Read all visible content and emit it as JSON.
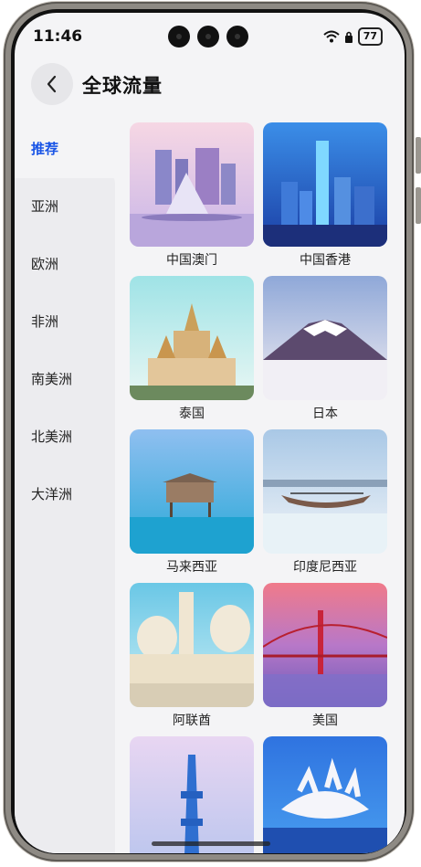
{
  "status": {
    "time": "11:46",
    "battery": "77"
  },
  "header": {
    "title": "全球流量",
    "back_icon": "chevron-left-icon"
  },
  "nav": {
    "items": [
      {
        "label": "推荐",
        "active": true
      },
      {
        "label": "亚洲"
      },
      {
        "label": "欧洲"
      },
      {
        "label": "非洲"
      },
      {
        "label": "南美洲"
      },
      {
        "label": "北美洲"
      },
      {
        "label": "大洋洲"
      }
    ]
  },
  "destinations": [
    {
      "label": "中国澳门"
    },
    {
      "label": "中国香港"
    },
    {
      "label": "泰国"
    },
    {
      "label": "日本"
    },
    {
      "label": "马来西亚"
    },
    {
      "label": "印度尼西亚"
    },
    {
      "label": "阿联酋"
    },
    {
      "label": "美国"
    },
    {
      "label": ""
    },
    {
      "label": ""
    }
  ],
  "colors": {
    "accent": "#1a55e6"
  }
}
